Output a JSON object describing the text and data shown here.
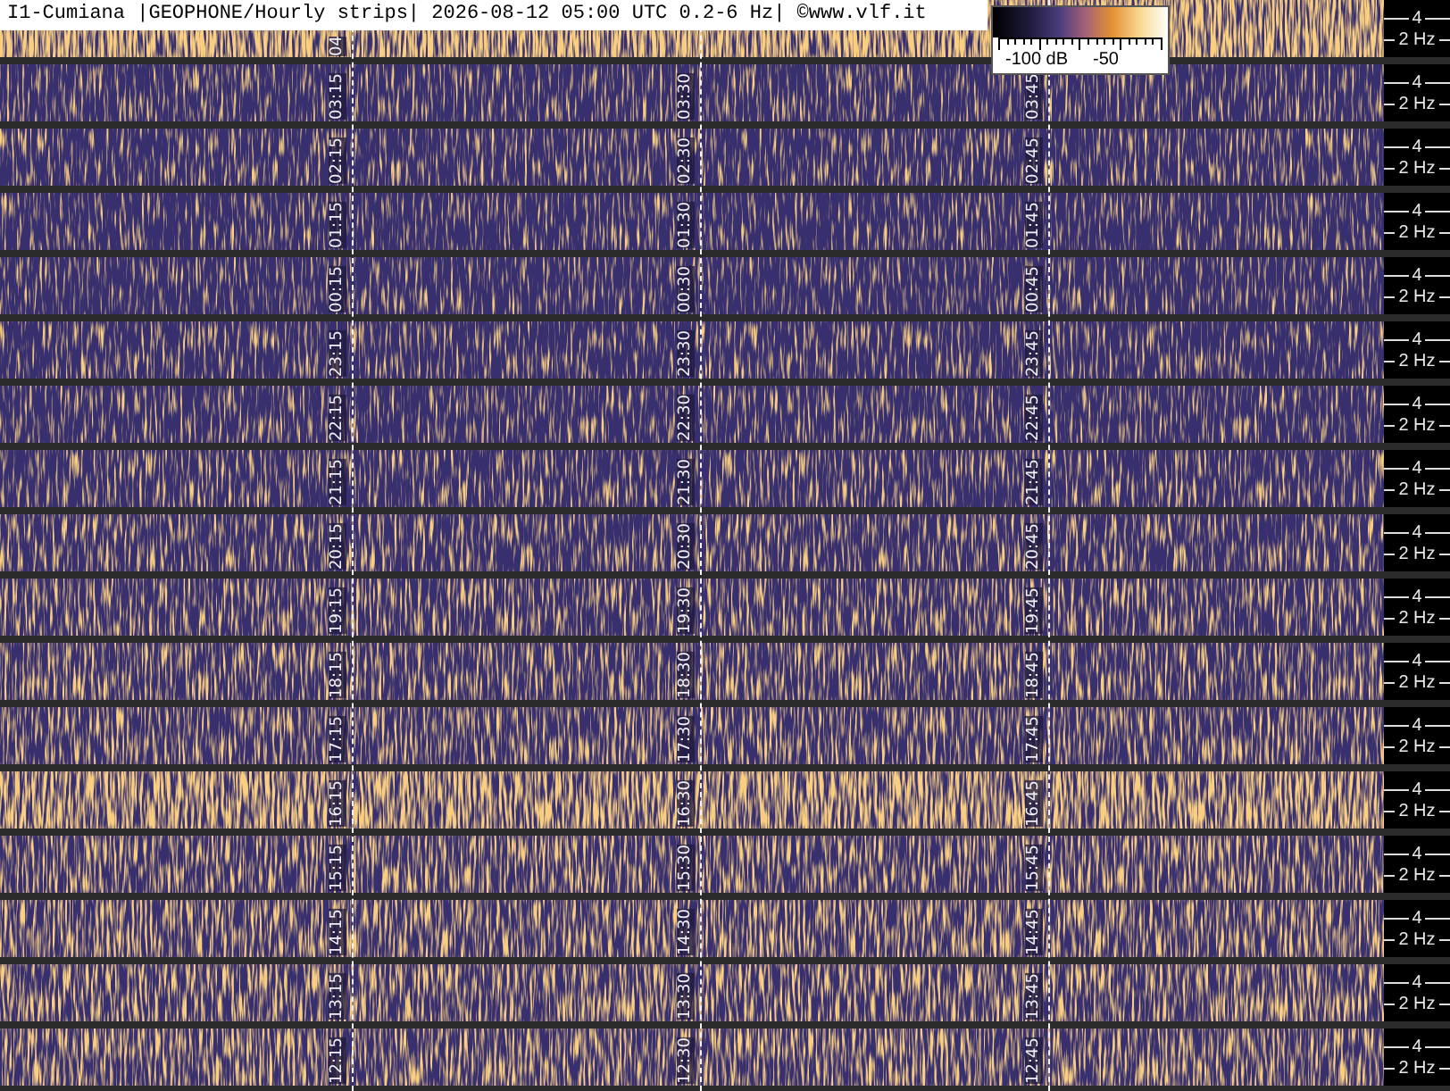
{
  "title": "I1-Cumiana |GEOPHONE/Hourly strips| 2026-08-12 05:00 UTC 0.2-6 Hz| ©www.vlf.it",
  "colorbar": {
    "labels": [
      "-100 dB",
      "-50"
    ]
  },
  "strips": [
    {
      "time_labels": [
        "04"
      ],
      "freq_labels": [
        "4",
        "2 Hz"
      ]
    },
    {
      "time_labels": [
        "03:15",
        "03:30",
        "03:45"
      ],
      "freq_labels": [
        "4",
        "2 Hz"
      ]
    },
    {
      "time_labels": [
        "02:15",
        "02:30",
        "02:45"
      ],
      "freq_labels": [
        "4",
        "2 Hz"
      ]
    },
    {
      "time_labels": [
        "01:15",
        "01:30",
        "01:45"
      ],
      "freq_labels": [
        "4",
        "2 Hz"
      ]
    },
    {
      "time_labels": [
        "00:15",
        "00:30",
        "00:45"
      ],
      "freq_labels": [
        "4",
        "2 Hz"
      ]
    },
    {
      "time_labels": [
        "23:15",
        "23:30",
        "23:45"
      ],
      "freq_labels": [
        "4",
        "2 Hz"
      ]
    },
    {
      "time_labels": [
        "22:15",
        "22:30",
        "22:45"
      ],
      "freq_labels": [
        "4",
        "2 Hz"
      ]
    },
    {
      "time_labels": [
        "21:15",
        "21:30",
        "21:45"
      ],
      "freq_labels": [
        "4",
        "2 Hz"
      ]
    },
    {
      "time_labels": [
        "20:15",
        "20:30",
        "20:45"
      ],
      "freq_labels": [
        "4",
        "2 Hz"
      ]
    },
    {
      "time_labels": [
        "19:15",
        "19:30",
        "19:45"
      ],
      "freq_labels": [
        "4",
        "2 Hz"
      ]
    },
    {
      "time_labels": [
        "18:15",
        "18:30",
        "18:45"
      ],
      "freq_labels": [
        "4",
        "2 Hz"
      ]
    },
    {
      "time_labels": [
        "17:15",
        "17:30",
        "17:45"
      ],
      "freq_labels": [
        "4",
        "2 Hz"
      ]
    },
    {
      "time_labels": [
        "16:15",
        "16:30",
        "16:45"
      ],
      "freq_labels": [
        "4",
        "2 Hz"
      ]
    },
    {
      "time_labels": [
        "15:15",
        "15:30",
        "15:45"
      ],
      "freq_labels": [
        "4",
        "2 Hz"
      ]
    },
    {
      "time_labels": [
        "14:15",
        "14:30",
        "14:45"
      ],
      "freq_labels": [
        "4",
        "2 Hz"
      ]
    },
    {
      "time_labels": [
        "13:15",
        "13:30",
        "13:45"
      ],
      "freq_labels": [
        "4",
        "2 Hz"
      ]
    },
    {
      "time_labels": [
        "12:15",
        "12:30",
        "12:45"
      ],
      "freq_labels": [
        "4",
        "2 Hz"
      ]
    }
  ]
}
